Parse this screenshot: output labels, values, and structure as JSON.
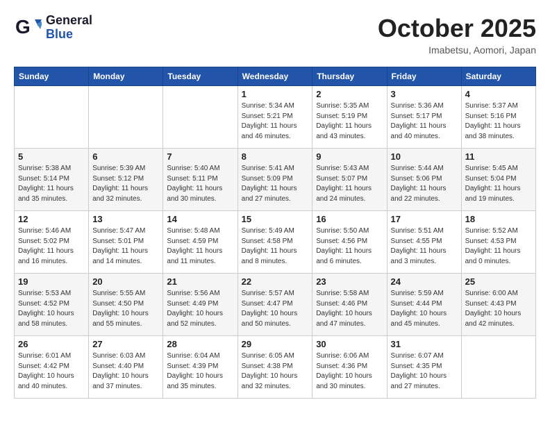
{
  "header": {
    "logo_line1": "General",
    "logo_line2": "Blue",
    "month": "October 2025",
    "location": "Imabetsu, Aomori, Japan"
  },
  "weekdays": [
    "Sunday",
    "Monday",
    "Tuesday",
    "Wednesday",
    "Thursday",
    "Friday",
    "Saturday"
  ],
  "weeks": [
    [
      {
        "day": "",
        "info": ""
      },
      {
        "day": "",
        "info": ""
      },
      {
        "day": "",
        "info": ""
      },
      {
        "day": "1",
        "info": "Sunrise: 5:34 AM\nSunset: 5:21 PM\nDaylight: 11 hours\nand 46 minutes."
      },
      {
        "day": "2",
        "info": "Sunrise: 5:35 AM\nSunset: 5:19 PM\nDaylight: 11 hours\nand 43 minutes."
      },
      {
        "day": "3",
        "info": "Sunrise: 5:36 AM\nSunset: 5:17 PM\nDaylight: 11 hours\nand 40 minutes."
      },
      {
        "day": "4",
        "info": "Sunrise: 5:37 AM\nSunset: 5:16 PM\nDaylight: 11 hours\nand 38 minutes."
      }
    ],
    [
      {
        "day": "5",
        "info": "Sunrise: 5:38 AM\nSunset: 5:14 PM\nDaylight: 11 hours\nand 35 minutes."
      },
      {
        "day": "6",
        "info": "Sunrise: 5:39 AM\nSunset: 5:12 PM\nDaylight: 11 hours\nand 32 minutes."
      },
      {
        "day": "7",
        "info": "Sunrise: 5:40 AM\nSunset: 5:11 PM\nDaylight: 11 hours\nand 30 minutes."
      },
      {
        "day": "8",
        "info": "Sunrise: 5:41 AM\nSunset: 5:09 PM\nDaylight: 11 hours\nand 27 minutes."
      },
      {
        "day": "9",
        "info": "Sunrise: 5:43 AM\nSunset: 5:07 PM\nDaylight: 11 hours\nand 24 minutes."
      },
      {
        "day": "10",
        "info": "Sunrise: 5:44 AM\nSunset: 5:06 PM\nDaylight: 11 hours\nand 22 minutes."
      },
      {
        "day": "11",
        "info": "Sunrise: 5:45 AM\nSunset: 5:04 PM\nDaylight: 11 hours\nand 19 minutes."
      }
    ],
    [
      {
        "day": "12",
        "info": "Sunrise: 5:46 AM\nSunset: 5:02 PM\nDaylight: 11 hours\nand 16 minutes."
      },
      {
        "day": "13",
        "info": "Sunrise: 5:47 AM\nSunset: 5:01 PM\nDaylight: 11 hours\nand 14 minutes."
      },
      {
        "day": "14",
        "info": "Sunrise: 5:48 AM\nSunset: 4:59 PM\nDaylight: 11 hours\nand 11 minutes."
      },
      {
        "day": "15",
        "info": "Sunrise: 5:49 AM\nSunset: 4:58 PM\nDaylight: 11 hours\nand 8 minutes."
      },
      {
        "day": "16",
        "info": "Sunrise: 5:50 AM\nSunset: 4:56 PM\nDaylight: 11 hours\nand 6 minutes."
      },
      {
        "day": "17",
        "info": "Sunrise: 5:51 AM\nSunset: 4:55 PM\nDaylight: 11 hours\nand 3 minutes."
      },
      {
        "day": "18",
        "info": "Sunrise: 5:52 AM\nSunset: 4:53 PM\nDaylight: 11 hours\nand 0 minutes."
      }
    ],
    [
      {
        "day": "19",
        "info": "Sunrise: 5:53 AM\nSunset: 4:52 PM\nDaylight: 10 hours\nand 58 minutes."
      },
      {
        "day": "20",
        "info": "Sunrise: 5:55 AM\nSunset: 4:50 PM\nDaylight: 10 hours\nand 55 minutes."
      },
      {
        "day": "21",
        "info": "Sunrise: 5:56 AM\nSunset: 4:49 PM\nDaylight: 10 hours\nand 52 minutes."
      },
      {
        "day": "22",
        "info": "Sunrise: 5:57 AM\nSunset: 4:47 PM\nDaylight: 10 hours\nand 50 minutes."
      },
      {
        "day": "23",
        "info": "Sunrise: 5:58 AM\nSunset: 4:46 PM\nDaylight: 10 hours\nand 47 minutes."
      },
      {
        "day": "24",
        "info": "Sunrise: 5:59 AM\nSunset: 4:44 PM\nDaylight: 10 hours\nand 45 minutes."
      },
      {
        "day": "25",
        "info": "Sunrise: 6:00 AM\nSunset: 4:43 PM\nDaylight: 10 hours\nand 42 minutes."
      }
    ],
    [
      {
        "day": "26",
        "info": "Sunrise: 6:01 AM\nSunset: 4:42 PM\nDaylight: 10 hours\nand 40 minutes."
      },
      {
        "day": "27",
        "info": "Sunrise: 6:03 AM\nSunset: 4:40 PM\nDaylight: 10 hours\nand 37 minutes."
      },
      {
        "day": "28",
        "info": "Sunrise: 6:04 AM\nSunset: 4:39 PM\nDaylight: 10 hours\nand 35 minutes."
      },
      {
        "day": "29",
        "info": "Sunrise: 6:05 AM\nSunset: 4:38 PM\nDaylight: 10 hours\nand 32 minutes."
      },
      {
        "day": "30",
        "info": "Sunrise: 6:06 AM\nSunset: 4:36 PM\nDaylight: 10 hours\nand 30 minutes."
      },
      {
        "day": "31",
        "info": "Sunrise: 6:07 AM\nSunset: 4:35 PM\nDaylight: 10 hours\nand 27 minutes."
      },
      {
        "day": "",
        "info": ""
      }
    ]
  ]
}
